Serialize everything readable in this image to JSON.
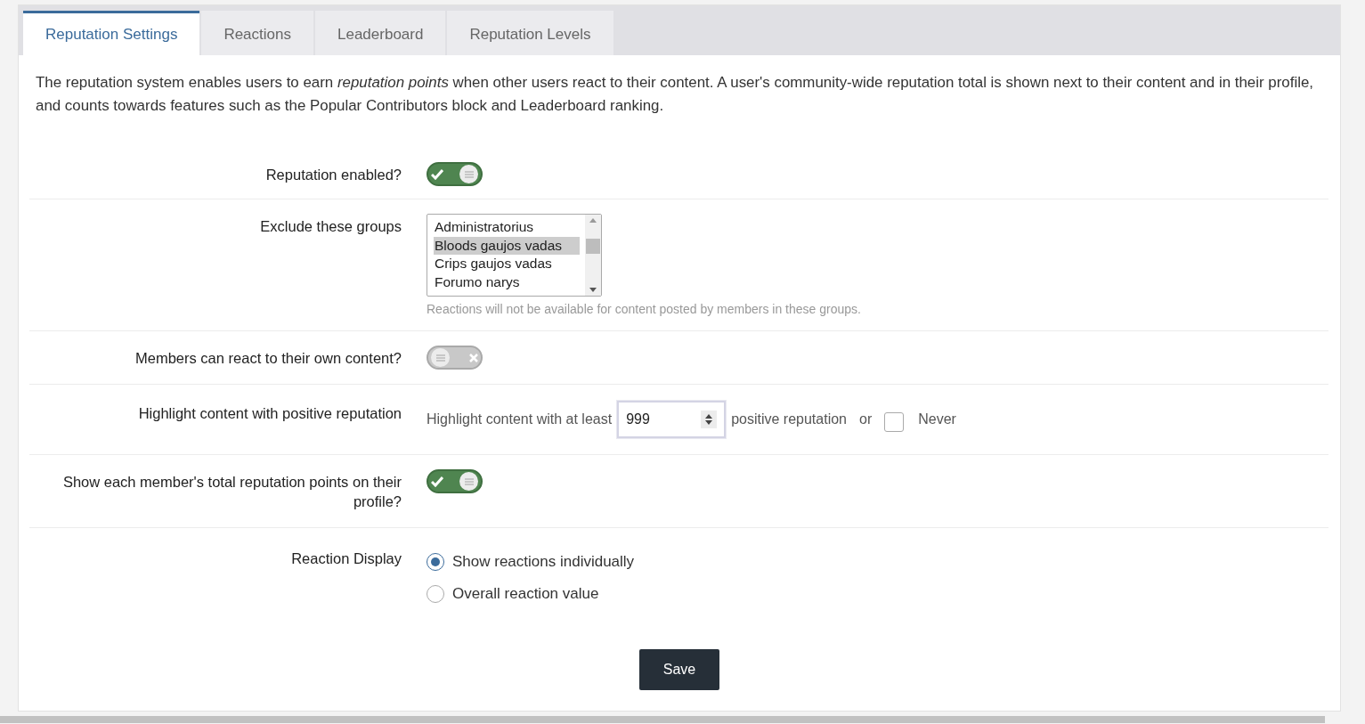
{
  "tabs": [
    {
      "label": "Reputation Settings",
      "selected": true
    },
    {
      "label": "Reactions",
      "selected": false
    },
    {
      "label": "Leaderboard",
      "selected": false
    },
    {
      "label": "Reputation Levels",
      "selected": false
    }
  ],
  "intro": "The reputation system enables users to earn *reputation points* when other users react to their content. A user's community-wide reputation total is shown next to their content and in their profile, and counts towards features such as the Popular Contributors block and Leaderboard ranking.",
  "settings": [
    {
      "kind": "toggle",
      "label": "Reputation enabled?",
      "on": true
    },
    {
      "kind": "listbox",
      "label": "Exclude these groups",
      "options": [
        {
          "label": "Administratorius",
          "selected": false
        },
        {
          "label": "Bloods gaujos vadas",
          "selected": true
        },
        {
          "label": "Crips gaujos vadas",
          "selected": false
        },
        {
          "label": "Forumo narys",
          "selected": false
        }
      ],
      "hint": "Reactions will not be available for content posted by members in these groups."
    },
    {
      "kind": "toggle",
      "label": "Members can react to their own content?",
      "on": false
    },
    {
      "kind": "highlight",
      "label": "Highlight content with positive reputation",
      "prefix": "Highlight content with at least",
      "value": "999",
      "suffix": "positive reputation",
      "or": "or",
      "checkbox_label": "Never",
      "checked": false
    },
    {
      "kind": "toggle",
      "label": "Show each member's total reputation points on their profile?",
      "on": true
    },
    {
      "kind": "radio",
      "label": "Reaction Display",
      "options": [
        {
          "label": "Show reactions individually",
          "selected": true
        },
        {
          "label": "Overall reaction value",
          "selected": false
        }
      ]
    }
  ],
  "save": "Save"
}
